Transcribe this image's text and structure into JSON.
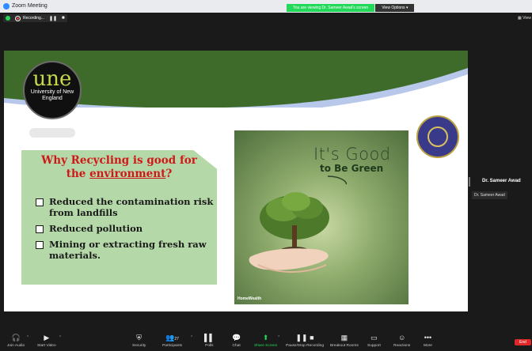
{
  "window": {
    "title": "Zoom Meeting"
  },
  "viewing_bar": {
    "text": "You are viewing Dr. Sameer Awad's screen",
    "options": "View Options ▾"
  },
  "recording": {
    "label": "Recording...",
    "pause": "❚❚",
    "stop": "■"
  },
  "view_button": "View",
  "slide": {
    "logo_text": "une",
    "logo_sub": "University of New England",
    "card_heading_part1": "Why Recycling is good for",
    "card_heading_part2": "the ",
    "card_heading_underlined": "environment",
    "card_heading_q": "?",
    "bullets": [
      "Reduced the contamination risk from landfills",
      "Reduced pollution",
      "Mining or extracting fresh raw materials."
    ],
    "image_text_1": "It's Good",
    "image_text_2": "to Be Green",
    "image_brand": "HomeWealth"
  },
  "participant": {
    "name": "Dr. Sameer Awad",
    "tile_name": "Dr. Sameer Awad"
  },
  "toolbar": {
    "join_audio": "Join Audio",
    "start_video": "Start Video",
    "security": "Security",
    "participants": "Participants",
    "participants_count": "27",
    "polls": "Polls",
    "chat": "Chat",
    "share_screen": "Share Screen",
    "pause_recording": "Pause/Stop Recording",
    "breakout": "Breakout Rooms",
    "support": "Support",
    "reactions": "Reactions",
    "more": "More",
    "end": "End"
  },
  "colors": {
    "accent_green": "#23d959",
    "band_green": "#3f6b2a",
    "band_blue": "#b8c8ea",
    "heading_red": "#d01818",
    "end_red": "#e02828"
  }
}
